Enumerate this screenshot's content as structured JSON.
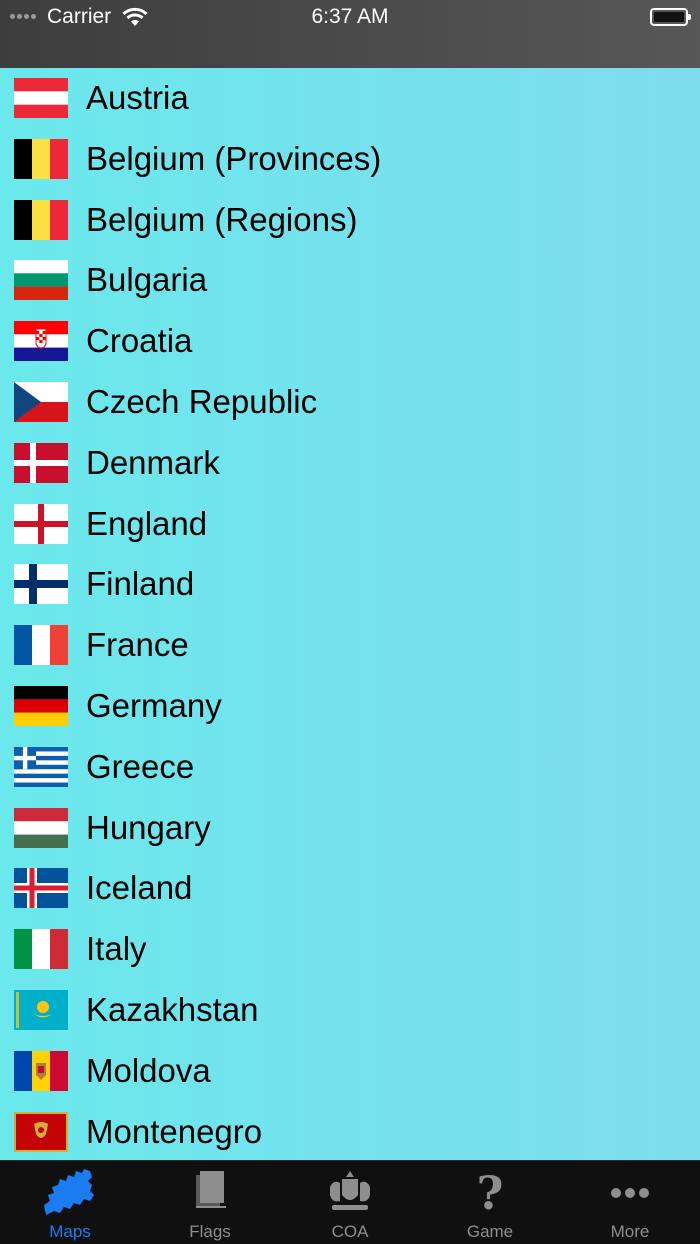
{
  "status_bar": {
    "carrier": "Carrier",
    "time": "6:37 AM"
  },
  "countries": [
    {
      "name": "Austria",
      "flag": "austria-flag"
    },
    {
      "name": "Belgium (Provinces)",
      "flag": "belgium-flag"
    },
    {
      "name": "Belgium (Regions)",
      "flag": "belgium-flag"
    },
    {
      "name": "Bulgaria",
      "flag": "bulgaria-flag"
    },
    {
      "name": "Croatia",
      "flag": "croatia-flag"
    },
    {
      "name": "Czech Republic",
      "flag": "czech-flag"
    },
    {
      "name": "Denmark",
      "flag": "denmark-flag"
    },
    {
      "name": "England",
      "flag": "england-flag"
    },
    {
      "name": "Finland",
      "flag": "finland-flag"
    },
    {
      "name": "France",
      "flag": "france-flag"
    },
    {
      "name": "Germany",
      "flag": "germany-flag"
    },
    {
      "name": "Greece",
      "flag": "greece-flag"
    },
    {
      "name": "Hungary",
      "flag": "hungary-flag"
    },
    {
      "name": "Iceland",
      "flag": "iceland-flag"
    },
    {
      "name": "Italy",
      "flag": "italy-flag"
    },
    {
      "name": "Kazakhstan",
      "flag": "kazakhstan-flag"
    },
    {
      "name": "Moldova",
      "flag": "moldova-flag"
    },
    {
      "name": "Montenegro",
      "flag": "montenegro-flag"
    }
  ],
  "tabs": [
    {
      "label": "Maps",
      "icon": "europe-map-icon",
      "active": true
    },
    {
      "label": "Flags",
      "icon": "flags-icon",
      "active": false
    },
    {
      "label": "COA",
      "icon": "coat-of-arms-icon",
      "active": false
    },
    {
      "label": "Game",
      "icon": "question-mark-icon",
      "active": false
    },
    {
      "label": "More",
      "icon": "more-dots-icon",
      "active": false
    }
  ],
  "colors": {
    "active_tab": "#1a7cf0",
    "inactive_tab": "#8e8e8e",
    "list_background": "#6ae8ec"
  }
}
